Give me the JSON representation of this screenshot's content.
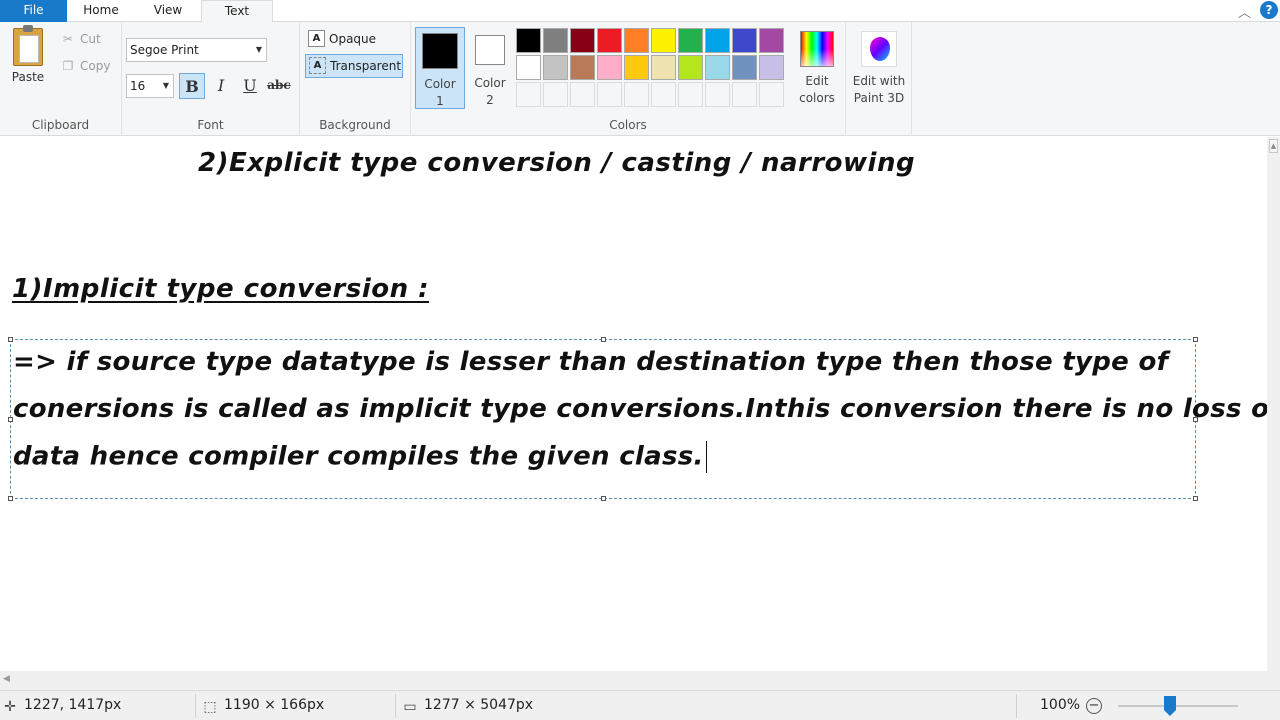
{
  "tabs": {
    "file": "File",
    "home": "Home",
    "view": "View",
    "text": "Text"
  },
  "window": {
    "collapse_icon": "chevron-up-icon",
    "help": "?"
  },
  "clipboard": {
    "paste": "Paste",
    "cut": "Cut",
    "copy": "Copy",
    "label": "Clipboard"
  },
  "font": {
    "family": "Segoe Print",
    "size": "16",
    "bold": "B",
    "italic": "I",
    "underline": "U",
    "strike": "abc",
    "label": "Font"
  },
  "background": {
    "opaque": "Opaque",
    "transparent": "Transparent",
    "label": "Background"
  },
  "colors": {
    "color1_label": "Color",
    "color1_num": "1",
    "color1_value": "#000000",
    "color2_label": "Color",
    "color2_num": "2",
    "color2_value": "#ffffff",
    "palette_row1": [
      "#000000",
      "#7f7f7f",
      "#880015",
      "#ed1c24",
      "#ff7f27",
      "#fff200",
      "#22b14c",
      "#00a2e8",
      "#3f48cc",
      "#a349a4"
    ],
    "palette_row2": [
      "#ffffff",
      "#c3c3c3",
      "#b97a57",
      "#ffaec9",
      "#ffc90e",
      "#efe4b0",
      "#b5e61d",
      "#99d9ea",
      "#7092be",
      "#c8bfe7"
    ],
    "edit_colors_1": "Edit",
    "edit_colors_2": "colors",
    "label": "Colors"
  },
  "paint3d": {
    "line1": "Edit with",
    "line2": "Paint 3D"
  },
  "canvas": {
    "heading2": "2)Explicit type conversion / casting / narrowing",
    "heading1": "1)Implicit type conversion :",
    "textbox_lines": [
      "=> if source type datatype is lesser than destination type then those type of",
      "conersions is called as implicit type conversions.Inthis conversion there is no loss of",
      "data hence compiler compiles the given class."
    ]
  },
  "status": {
    "cursor": "1227, 1417px",
    "selection": "1190 × 166px",
    "image_size": "1277 × 5047px",
    "zoom": "100%"
  }
}
